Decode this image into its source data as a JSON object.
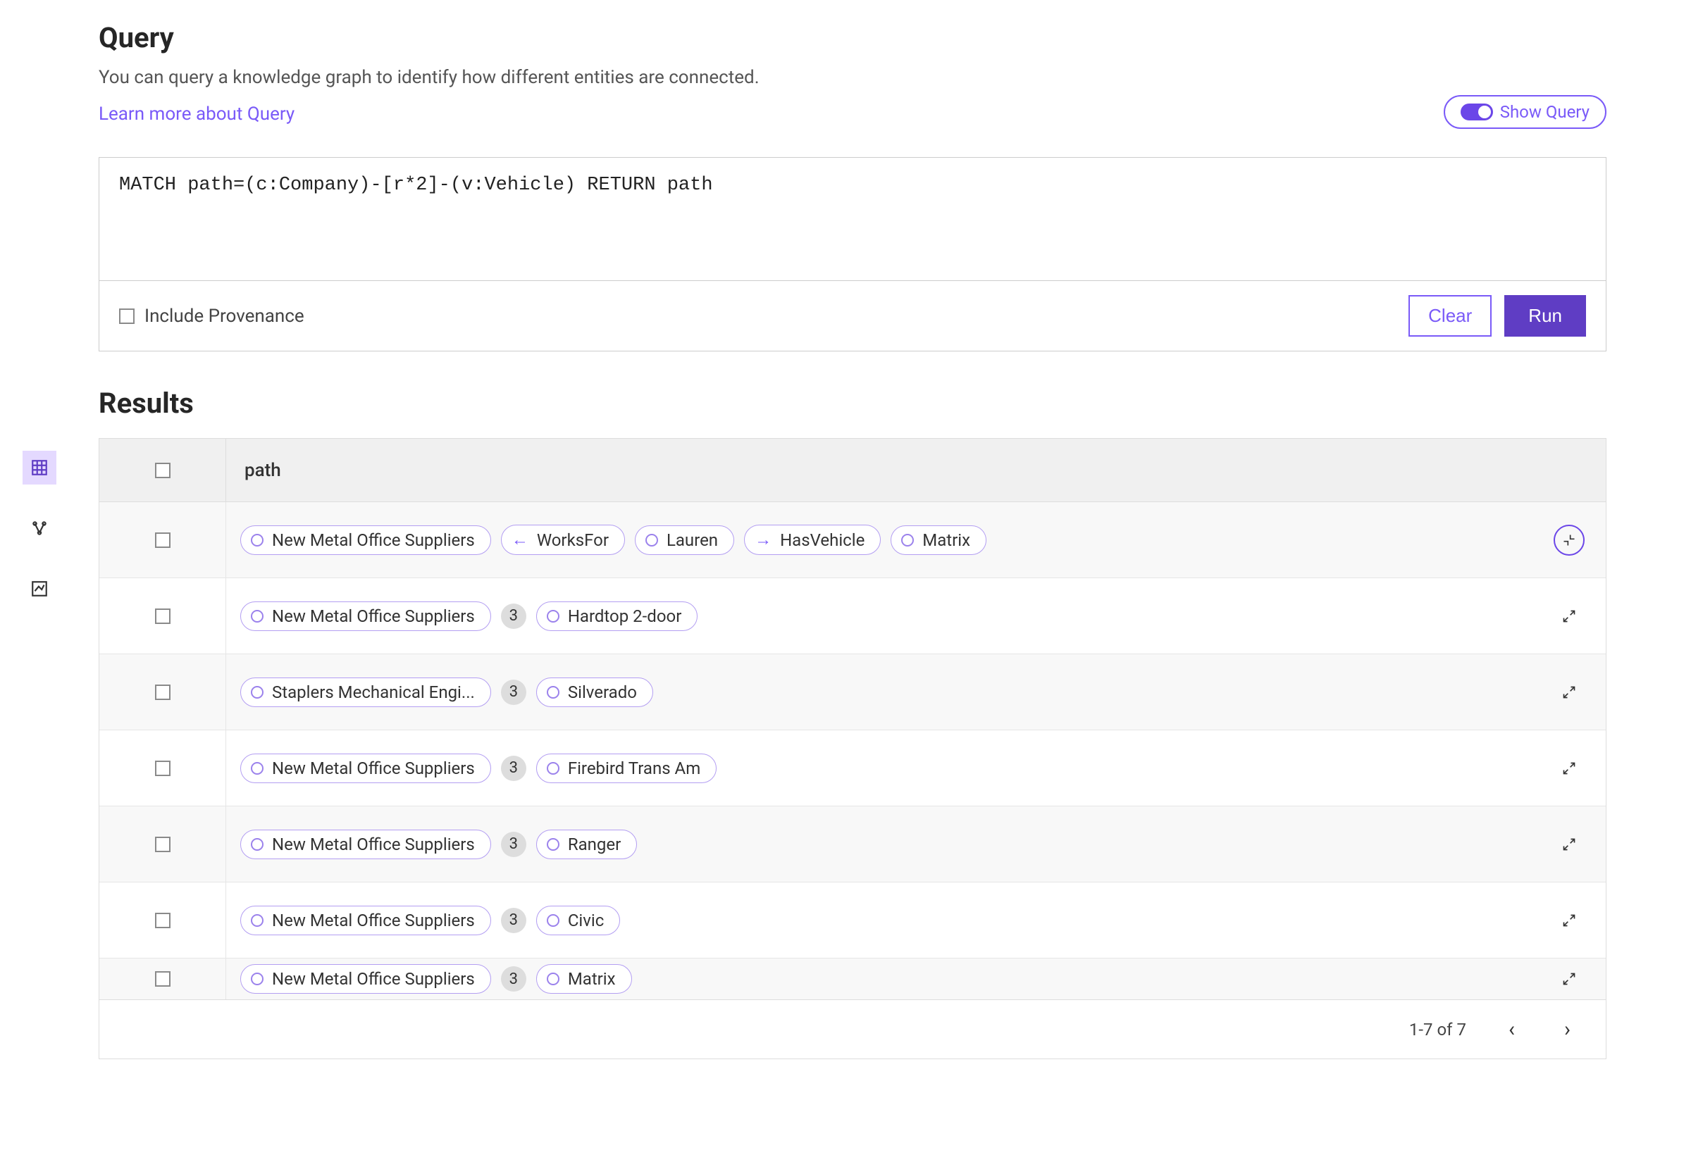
{
  "header": {
    "title": "Query",
    "subtitle": "You can query a knowledge graph to identify how different entities are connected.",
    "learn_more": "Learn more about Query",
    "show_query_label": "Show Query"
  },
  "query_box": {
    "value": "MATCH path=(c:Company)-[r*2]-(v:Vehicle) RETURN path",
    "include_provenance_label": "Include Provenance",
    "clear_label": "Clear",
    "run_label": "Run"
  },
  "results": {
    "title": "Results",
    "column_header": "path",
    "rows": [
      {
        "expanded": true,
        "pills": [
          {
            "type": "entity",
            "label": "New Metal Office Suppliers"
          },
          {
            "type": "rel",
            "dir": "left",
            "label": "WorksFor"
          },
          {
            "type": "entity",
            "label": "Lauren"
          },
          {
            "type": "rel",
            "dir": "right",
            "label": "HasVehicle"
          },
          {
            "type": "entity",
            "label": "Matrix"
          }
        ]
      },
      {
        "expanded": false,
        "pills": [
          {
            "type": "entity",
            "label": "New Metal Office Suppliers"
          },
          {
            "type": "count",
            "label": "3"
          },
          {
            "type": "entity",
            "label": "Hardtop 2-door"
          }
        ]
      },
      {
        "expanded": false,
        "pills": [
          {
            "type": "entity",
            "label": "Staplers Mechanical Engi..."
          },
          {
            "type": "count",
            "label": "3"
          },
          {
            "type": "entity",
            "label": "Silverado"
          }
        ]
      },
      {
        "expanded": false,
        "pills": [
          {
            "type": "entity",
            "label": "New Metal Office Suppliers"
          },
          {
            "type": "count",
            "label": "3"
          },
          {
            "type": "entity",
            "label": "Firebird Trans Am"
          }
        ]
      },
      {
        "expanded": false,
        "pills": [
          {
            "type": "entity",
            "label": "New Metal Office Suppliers"
          },
          {
            "type": "count",
            "label": "3"
          },
          {
            "type": "entity",
            "label": "Ranger"
          }
        ]
      },
      {
        "expanded": false,
        "pills": [
          {
            "type": "entity",
            "label": "New Metal Office Suppliers"
          },
          {
            "type": "count",
            "label": "3"
          },
          {
            "type": "entity",
            "label": "Civic"
          }
        ]
      },
      {
        "expanded": false,
        "cut": true,
        "pills": [
          {
            "type": "entity",
            "label": "New Metal Office Suppliers"
          },
          {
            "type": "count",
            "label": "3"
          },
          {
            "type": "entity",
            "label": "Matrix"
          }
        ]
      }
    ],
    "pager": {
      "range": "1-7 of 7"
    }
  }
}
